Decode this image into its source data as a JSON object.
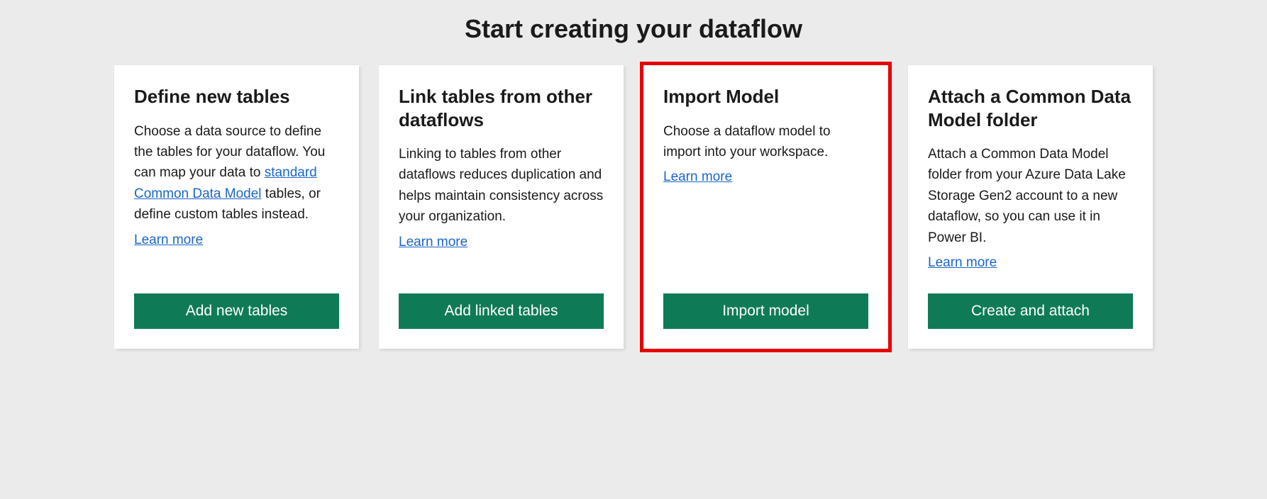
{
  "page": {
    "title": "Start creating your dataflow"
  },
  "cards": [
    {
      "title": "Define new tables",
      "desc_pre": "Choose a data source to define the tables for your dataflow. You can map your data to ",
      "link_text": "standard Common Data Model",
      "desc_post": " tables, or define custom tables instead.",
      "learn_more": "Learn more",
      "button": "Add new tables"
    },
    {
      "title": "Link tables from other dataflows",
      "desc": "Linking to tables from other dataflows reduces duplication and helps maintain consistency across your organization.",
      "learn_more": "Learn more",
      "button": "Add linked tables"
    },
    {
      "title": "Import Model",
      "desc": "Choose a dataflow model to import into your workspace.",
      "learn_more": "Learn more",
      "button": "Import model"
    },
    {
      "title": "Attach a Common Data Model folder",
      "desc": "Attach a Common Data Model folder from your Azure Data Lake Storage Gen2 account to a new dataflow, so you can use it in Power BI.",
      "learn_more": "Learn more",
      "button": "Create and attach"
    }
  ]
}
